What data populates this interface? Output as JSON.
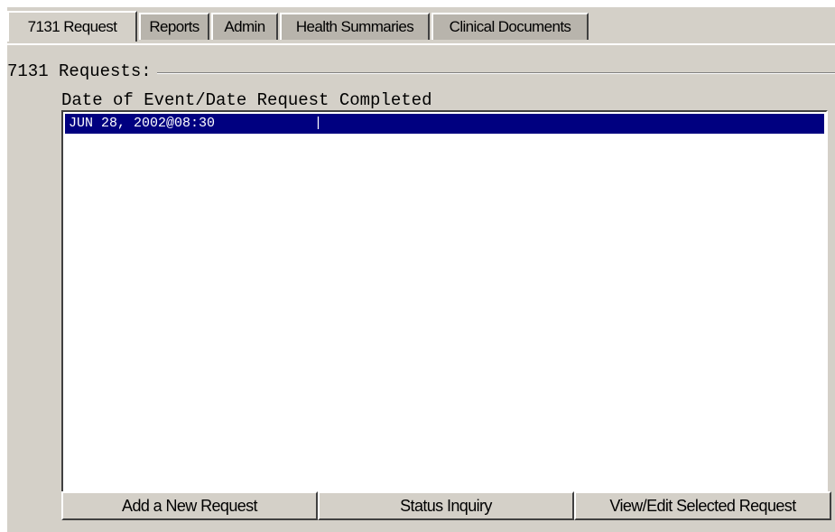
{
  "tabs": [
    {
      "label": "7131 Request",
      "active": true
    },
    {
      "label": "Reports",
      "active": false
    },
    {
      "label": "Admin",
      "active": false
    },
    {
      "label": "Health Summaries",
      "active": false
    },
    {
      "label": "Clinical Documents",
      "active": false
    }
  ],
  "requests_group": {
    "title": "7131 Requests:",
    "column_header": "Date of Event/Date Request Completed",
    "rows": [
      {
        "date_of_event": "JUN 28, 2002@08:30",
        "date_completed": "|",
        "selected": true
      }
    ]
  },
  "buttons": {
    "add_new": "Add a New Request",
    "status_inquiry": "Status Inquiry",
    "view_edit": "View/Edit Selected Request"
  },
  "colors": {
    "window_face": "#d4d0c8",
    "selection": "#000080",
    "list_background": "#ffffff"
  }
}
